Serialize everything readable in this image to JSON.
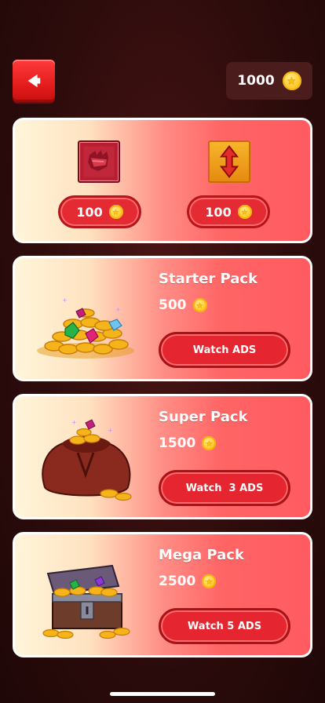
{
  "header": {
    "back_icon": "back-arrow-icon",
    "coin_balance": "1000",
    "coin_icon": "coin-icon"
  },
  "powerups": [
    {
      "icon": "glove-powerup-icon",
      "price": "100"
    },
    {
      "icon": "vertical-arrows-powerup-icon",
      "price": "100"
    }
  ],
  "packs": [
    {
      "title": "Starter Pack",
      "price": "500",
      "button": "Watch ADS",
      "image": "coins-and-gems-pile"
    },
    {
      "title": "Super Pack",
      "price": "1500",
      "button": "Watch  3 ADS",
      "image": "coin-sack"
    },
    {
      "title": "Mega Pack",
      "price": "2500",
      "button": "Watch 5 ADS",
      "image": "treasure-chest"
    }
  ],
  "colors": {
    "background": "#2e0c0c",
    "accent_red": "#e52630",
    "coin_gold": "#ffcc2e",
    "card_border": "#ffffff"
  }
}
